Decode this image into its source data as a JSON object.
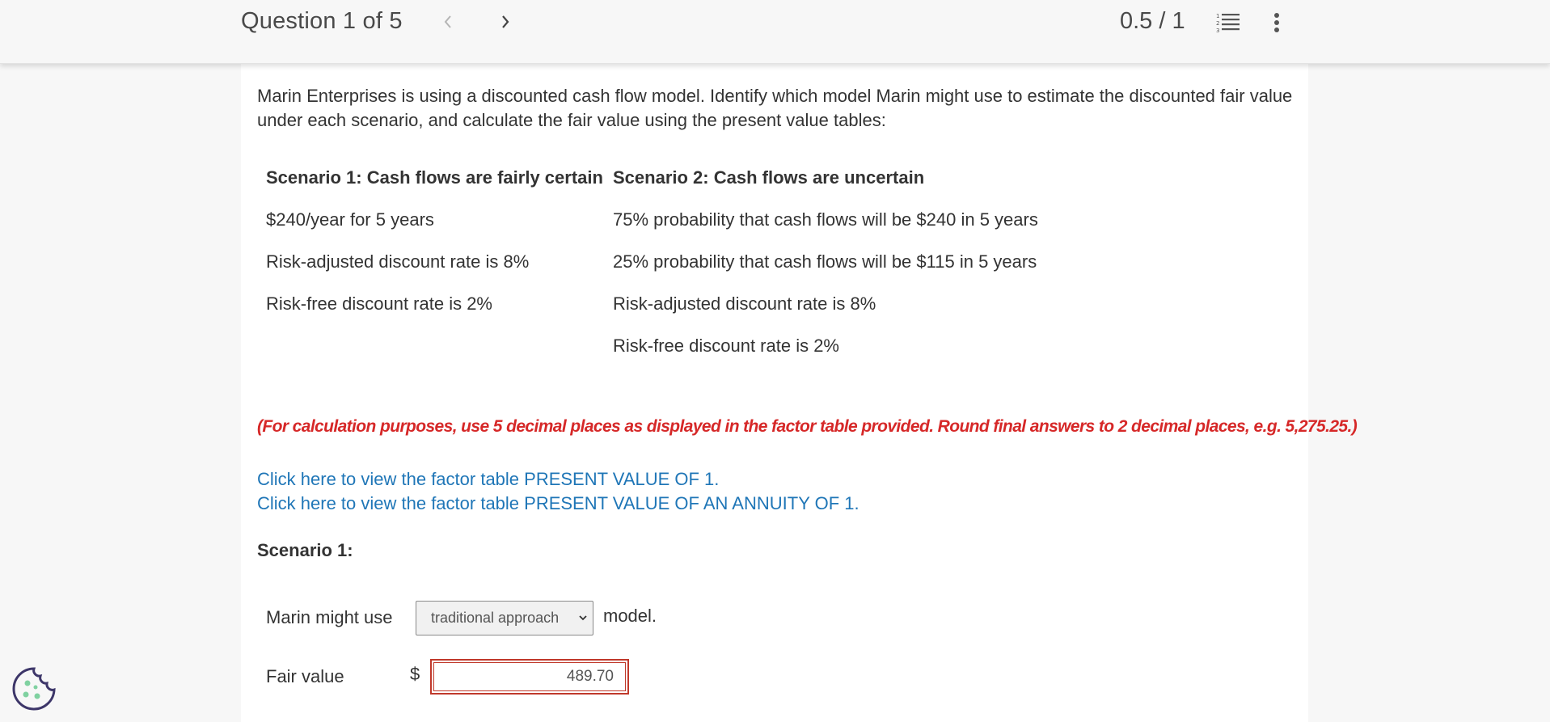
{
  "header": {
    "question_label": "Question 1 of 5",
    "score": "0.5 / 1",
    "prev_icon": "chevron-left-icon",
    "next_icon": "chevron-right-icon",
    "list_icon": "numbered-list-icon",
    "more_icon": "vertical-ellipsis-icon"
  },
  "question": {
    "prompt": "Marin Enterprises is using a discounted cash flow model. Identify which model Marin might use to estimate the discounted fair value under each scenario, and calculate the fair value using the present value tables:",
    "scenario1": {
      "heading": "Scenario 1: Cash flows are fairly certain",
      "lines": [
        "$240/year for 5 years",
        "Risk-adjusted discount rate is 8%",
        "Risk-free discount rate is 2%"
      ]
    },
    "scenario2": {
      "heading": "Scenario 2: Cash flows are uncertain",
      "lines": [
        "75% probability that cash flows will be $240 in 5 years",
        "25% probability that cash flows will be $115 in 5 years",
        "Risk-adjusted discount rate is 8%",
        "Risk-free discount rate is 2%"
      ]
    },
    "instruction": "(For calculation purposes, use 5 decimal places as displayed in the factor table provided. Round final answers to 2 decimal places, e.g. 5,275.25.)",
    "links": [
      "Click here to view the factor table PRESENT VALUE OF 1.",
      "Click here to view the factor table PRESENT VALUE OF AN ANNUITY OF 1."
    ]
  },
  "answer": {
    "section_label": "Scenario 1:",
    "use_label": "Marin might use",
    "model_select_value": "traditional approach",
    "model_suffix": "model.",
    "fair_value_label": "Fair value",
    "currency": "$",
    "fair_value": "489.70",
    "error_color": "#c0392b"
  },
  "footer": {
    "cookie_icon": "cookie-settings-icon"
  },
  "colors": {
    "link": "#1f76b7",
    "instruction": "#d62828",
    "page_bg": "#f7f7f7",
    "content_bg": "#ffffff"
  }
}
